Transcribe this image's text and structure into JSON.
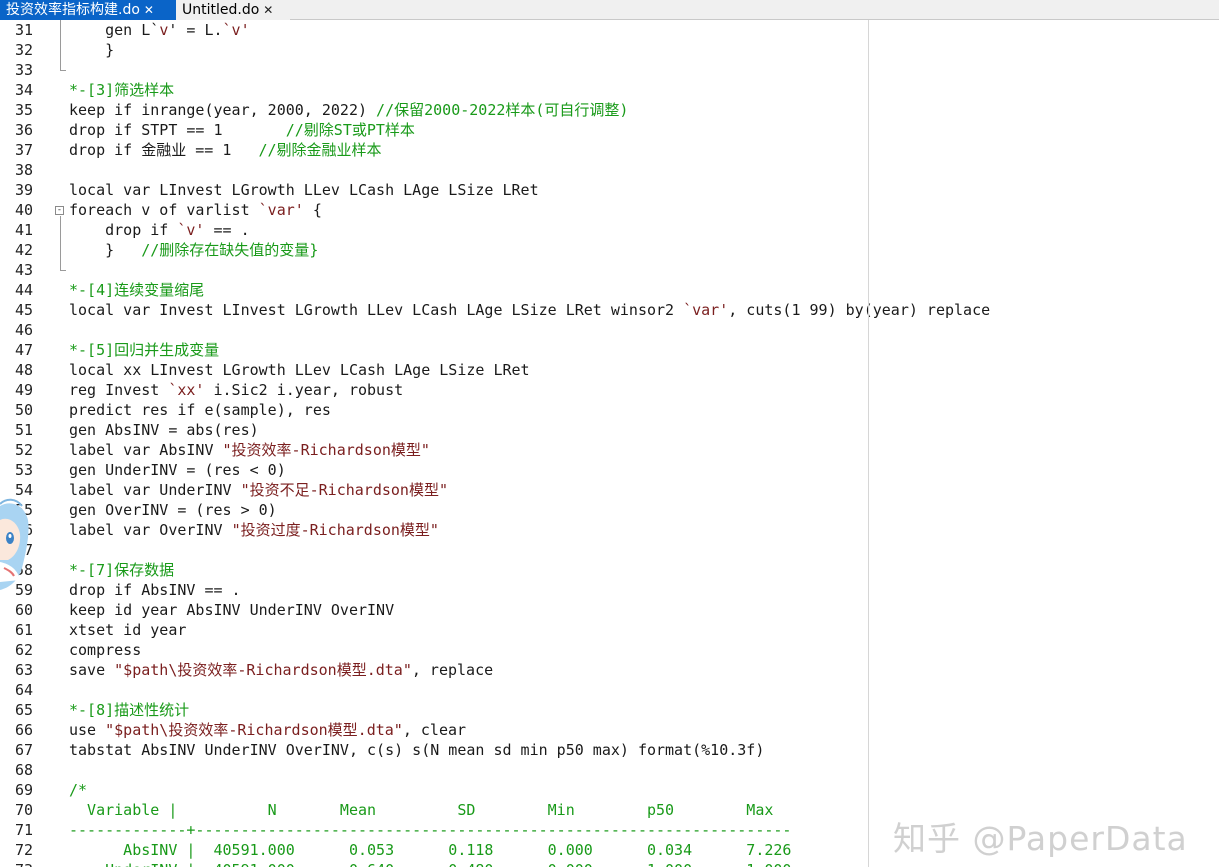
{
  "tabs": [
    {
      "label": "投资效率指标构建.do",
      "active": true
    },
    {
      "label": "Untitled.do",
      "active": false
    }
  ],
  "close_glyph": "✕",
  "watermark": "知乎 @PaperData",
  "colors": {
    "active_tab": "#0a64c8",
    "comment": "#199a19",
    "string": "#7a1e1e",
    "text": "#1a1a1a"
  },
  "lines": [
    {
      "n": "31",
      "segs": [
        [
          "t",
          "    gen L`"
        ],
        [
          "s",
          "v"
        ],
        [
          "t",
          "' = L."
        ],
        [
          "s",
          "`v'"
        ]
      ]
    },
    {
      "n": "32",
      "segs": [
        [
          "t",
          "    }"
        ]
      ]
    },
    {
      "n": "33",
      "segs": []
    },
    {
      "n": "34",
      "segs": [
        [
          "c",
          "*-[3]筛选样本"
        ]
      ]
    },
    {
      "n": "35",
      "segs": [
        [
          "t",
          "keep if inrange(year, 2000, 2022) "
        ],
        [
          "c",
          "//保留2000-2022样本(可自行调整)"
        ]
      ]
    },
    {
      "n": "36",
      "segs": [
        [
          "t",
          "drop if STPT == 1       "
        ],
        [
          "c",
          "//剔除ST或PT样本"
        ]
      ]
    },
    {
      "n": "37",
      "segs": [
        [
          "t",
          "drop if 金融业 == 1   "
        ],
        [
          "c",
          "//剔除金融业样本"
        ]
      ]
    },
    {
      "n": "38",
      "segs": []
    },
    {
      "n": "39",
      "segs": [
        [
          "t",
          "local var LInvest LGrowth LLev LCash LAge LSize LRet"
        ]
      ]
    },
    {
      "n": "40",
      "segs": [
        [
          "t",
          "foreach v of varlist "
        ],
        [
          "s",
          "`var'"
        ],
        [
          "t",
          " {"
        ]
      ]
    },
    {
      "n": "41",
      "segs": [
        [
          "t",
          "    drop if "
        ],
        [
          "s",
          "`v'"
        ],
        [
          "t",
          " == ."
        ]
      ]
    },
    {
      "n": "42",
      "segs": [
        [
          "t",
          "    }   "
        ],
        [
          "c",
          "//删除存在缺失值的变量}"
        ]
      ]
    },
    {
      "n": "43",
      "segs": []
    },
    {
      "n": "44",
      "segs": [
        [
          "c",
          "*-[4]连续变量缩尾"
        ]
      ]
    },
    {
      "n": "45",
      "segs": [
        [
          "t",
          "local var Invest LInvest LGrowth LLev LCash LAge LSize LRet winsor2 "
        ],
        [
          "s",
          "`var'"
        ],
        [
          "t",
          ", cuts(1 99) by(year) replace"
        ]
      ]
    },
    {
      "n": "46",
      "segs": []
    },
    {
      "n": "47",
      "segs": [
        [
          "c",
          "*-[5]回归并生成变量"
        ]
      ]
    },
    {
      "n": "48",
      "segs": [
        [
          "t",
          "local xx LInvest LGrowth LLev LCash LAge LSize LRet"
        ]
      ]
    },
    {
      "n": "49",
      "segs": [
        [
          "t",
          "reg Invest "
        ],
        [
          "s",
          "`xx'"
        ],
        [
          "t",
          " i.Sic2 i.year, robust"
        ]
      ]
    },
    {
      "n": "50",
      "segs": [
        [
          "t",
          "predict res if e(sample), res"
        ]
      ]
    },
    {
      "n": "51",
      "segs": [
        [
          "t",
          "gen AbsINV = abs(res)"
        ]
      ]
    },
    {
      "n": "52",
      "segs": [
        [
          "t",
          "label var AbsINV "
        ],
        [
          "s",
          "\"投资效率-Richardson模型\""
        ]
      ]
    },
    {
      "n": "53",
      "segs": [
        [
          "t",
          "gen UnderINV = (res < 0)"
        ]
      ]
    },
    {
      "n": "54",
      "segs": [
        [
          "t",
          "label var UnderINV "
        ],
        [
          "s",
          "\"投资不足-Richardson模型\""
        ]
      ]
    },
    {
      "n": "55",
      "segs": [
        [
          "t",
          "gen OverINV = (res > 0)"
        ]
      ]
    },
    {
      "n": "56",
      "segs": [
        [
          "t",
          "label var OverINV "
        ],
        [
          "s",
          "\"投资过度-Richardson模型\""
        ]
      ]
    },
    {
      "n": "57",
      "segs": []
    },
    {
      "n": "58",
      "segs": [
        [
          "c",
          "*-[7]保存数据"
        ]
      ]
    },
    {
      "n": "59",
      "segs": [
        [
          "t",
          "drop if AbsINV == ."
        ]
      ]
    },
    {
      "n": "60",
      "segs": [
        [
          "t",
          "keep id year AbsINV UnderINV OverINV"
        ]
      ]
    },
    {
      "n": "61",
      "segs": [
        [
          "t",
          "xtset id year"
        ]
      ]
    },
    {
      "n": "62",
      "segs": [
        [
          "t",
          "compress"
        ]
      ]
    },
    {
      "n": "63",
      "segs": [
        [
          "t",
          "save "
        ],
        [
          "s",
          "\"$path\\投资效率-Richardson模型.dta\""
        ],
        [
          "t",
          ", replace"
        ]
      ]
    },
    {
      "n": "64",
      "segs": []
    },
    {
      "n": "65",
      "segs": [
        [
          "c",
          "*-[8]描述性统计"
        ]
      ]
    },
    {
      "n": "66",
      "segs": [
        [
          "t",
          "use "
        ],
        [
          "s",
          "\"$path\\投资效率-Richardson模型.dta\""
        ],
        [
          "t",
          ", clear"
        ]
      ]
    },
    {
      "n": "67",
      "segs": [
        [
          "t",
          "tabstat AbsINV UnderINV OverINV, c(s) s(N mean sd min p50 max) format(%10.3f)"
        ]
      ]
    },
    {
      "n": "68",
      "segs": []
    },
    {
      "n": "69",
      "segs": [
        [
          "c",
          "/*"
        ]
      ]
    },
    {
      "n": "70",
      "segs": [
        [
          "c",
          "  Variable |          N       Mean         SD        Min        p50        Max"
        ]
      ]
    },
    {
      "n": "71",
      "segs": [
        [
          "c",
          "-------------+------------------------------------------------------------------"
        ]
      ]
    },
    {
      "n": "72",
      "segs": [
        [
          "c",
          "      AbsINV |  40591.000      0.053      0.118      0.000      0.034      7.226"
        ]
      ]
    },
    {
      "n": "73",
      "segs": [
        [
          "c",
          "    UnderINV |  40591.000      0.640      0.480      0.000      1.000      1.000"
        ]
      ]
    }
  ]
}
